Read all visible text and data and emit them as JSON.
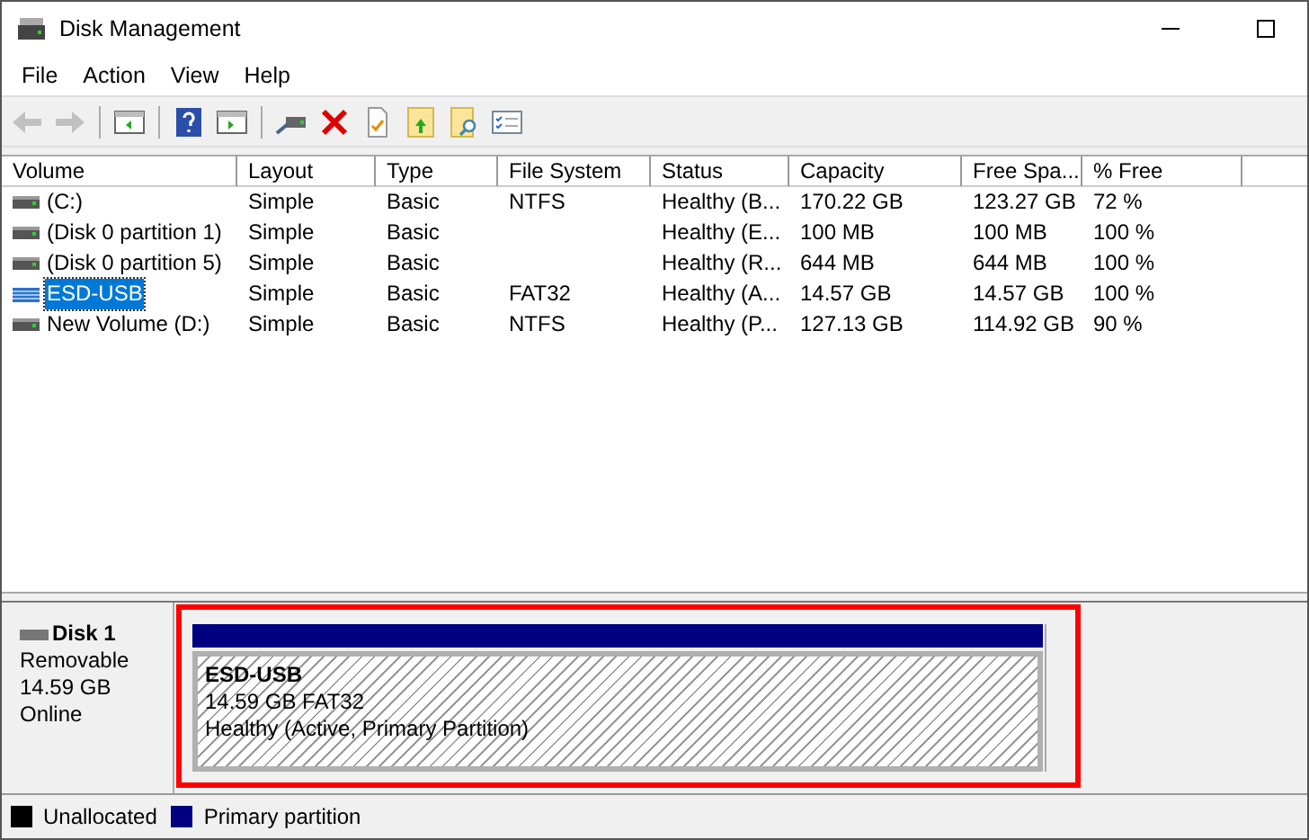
{
  "window": {
    "title": "Disk Management"
  },
  "menu": [
    "File",
    "Action",
    "View",
    "Help"
  ],
  "toolbar": [
    {
      "kind": "back",
      "disabled": true
    },
    {
      "kind": "forward",
      "disabled": true
    },
    {
      "kind": "sep"
    },
    {
      "kind": "panel-left",
      "disabled": false
    },
    {
      "kind": "sep"
    },
    {
      "kind": "help",
      "disabled": false
    },
    {
      "kind": "panel-right",
      "disabled": false
    },
    {
      "kind": "sep"
    },
    {
      "kind": "connect",
      "disabled": false
    },
    {
      "kind": "delete",
      "disabled": false
    },
    {
      "kind": "properties",
      "disabled": false
    },
    {
      "kind": "folder-up",
      "disabled": false
    },
    {
      "kind": "folder-search",
      "disabled": false
    },
    {
      "kind": "checklist",
      "disabled": false
    }
  ],
  "table": {
    "columns": [
      "Volume",
      "Layout",
      "Type",
      "File System",
      "Status",
      "Capacity",
      "Free Spa...",
      "% Free"
    ],
    "rows": [
      {
        "kind": "fixed",
        "selected": false,
        "cells": [
          "(C:)",
          "Simple",
          "Basic",
          "NTFS",
          "Healthy (B...",
          "170.22 GB",
          "123.27 GB",
          "72 %"
        ]
      },
      {
        "kind": "fixed",
        "selected": false,
        "cells": [
          "(Disk 0 partition 1)",
          "Simple",
          "Basic",
          "",
          "Healthy (E...",
          "100 MB",
          "100 MB",
          "100 %"
        ]
      },
      {
        "kind": "fixed",
        "selected": false,
        "cells": [
          "(Disk 0 partition 5)",
          "Simple",
          "Basic",
          "",
          "Healthy (R...",
          "644 MB",
          "644 MB",
          "100 %"
        ]
      },
      {
        "kind": "removable",
        "selected": true,
        "cells": [
          "ESD-USB",
          "Simple",
          "Basic",
          "FAT32",
          "Healthy (A...",
          "14.57 GB",
          "14.57 GB",
          "100 %"
        ]
      },
      {
        "kind": "fixed",
        "selected": false,
        "cells": [
          "New Volume (D:)",
          "Simple",
          "Basic",
          "NTFS",
          "Healthy (P...",
          "127.13 GB",
          "114.92 GB",
          "90 %"
        ]
      }
    ]
  },
  "disk": {
    "name": "Disk 1",
    "type": "Removable",
    "size": "14.59 GB",
    "status": "Online",
    "highlighted": true,
    "partitions": [
      {
        "name": "ESD-USB",
        "size": "14.59 GB FAT32",
        "status": "Healthy (Active, Primary Partition)",
        "selected": true,
        "color": "#000080"
      }
    ]
  },
  "legend": [
    {
      "label": "Unallocated",
      "color": "#000000"
    },
    {
      "label": "Primary partition",
      "color": "#000080"
    }
  ]
}
